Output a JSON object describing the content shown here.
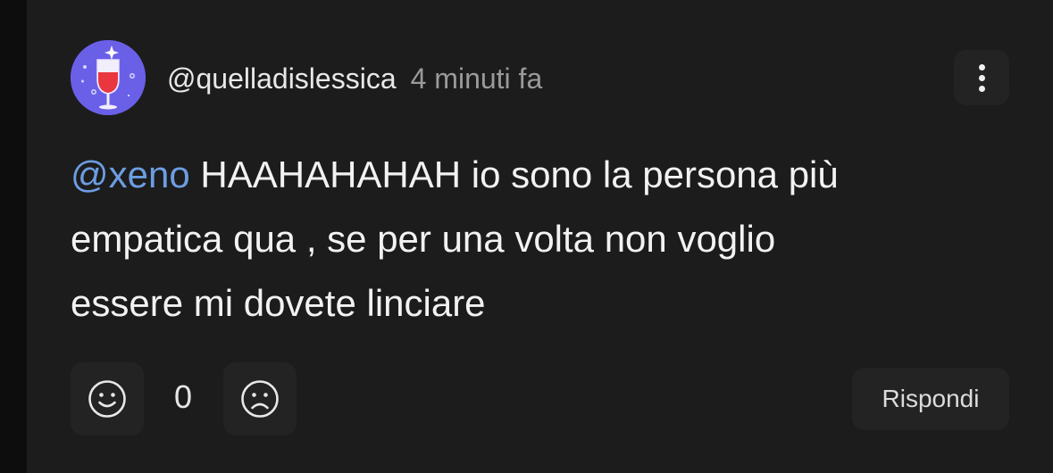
{
  "comment": {
    "author": "@quelladislessica",
    "time": "4 minuti fa",
    "mention": "@xeno",
    "line1": " HAAHAHAHAH io sono la persona più",
    "line2": "empatica qua , se per una volta non voglio",
    "line3": "essere mi dovete linciare",
    "avatar_icon": "wine-glass-icon",
    "avatar_color": "#6a60e8",
    "mention_color": "#6c9de2"
  },
  "actions": {
    "like_icon": "smile-icon",
    "dislike_icon": "frown-icon",
    "count": "0",
    "more_icon": "more-vertical-icon",
    "reply_label": "Rispondi"
  }
}
